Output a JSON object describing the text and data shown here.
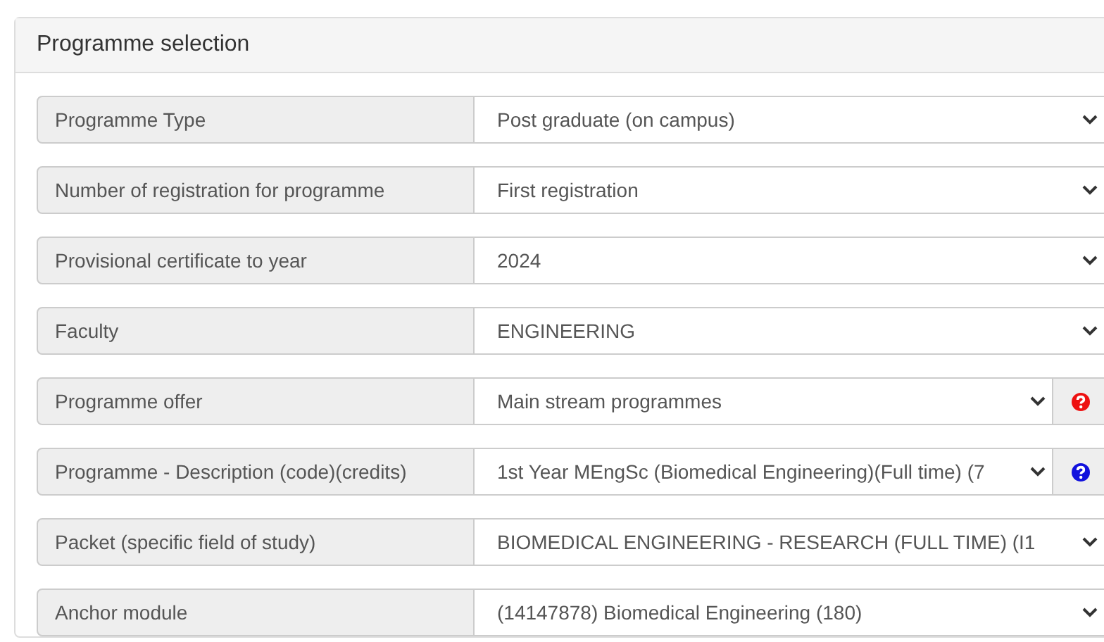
{
  "panel": {
    "title": "Programme selection"
  },
  "rows": [
    {
      "label": "Programme Type",
      "value": "Post graduate (on campus)"
    },
    {
      "label": "Number of registration for programme",
      "value": "First registration"
    },
    {
      "label": "Provisional certificate to year",
      "value": "2024"
    },
    {
      "label": "Faculty",
      "value": "ENGINEERING"
    },
    {
      "label": "Programme offer",
      "value": "Main stream programmes",
      "help": {
        "color": "#ee1111"
      }
    },
    {
      "label": "Programme - Description (code)(credits)",
      "value": "1st Year MEngSc (Biomedical Engineering)(Full time) (7",
      "help": {
        "color": "#1111dd"
      }
    },
    {
      "label": "Packet (specific field of study)",
      "value": "BIOMEDICAL ENGINEERING - RESEARCH (FULL TIME) (I1"
    },
    {
      "label": "Anchor module",
      "value": "(14147878) Biomedical Engineering (180)"
    }
  ]
}
